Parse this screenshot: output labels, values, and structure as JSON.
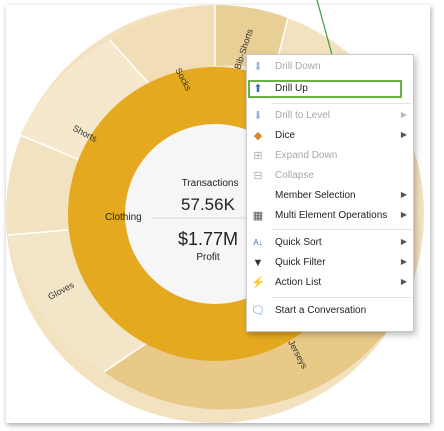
{
  "chart": {
    "center_top_label": "Transactions",
    "center_top_value": "57.56K",
    "center_bottom_value": "$1.77M",
    "center_bottom_label": "Profit",
    "inner_label": "Clothing",
    "outer_labels": {
      "socks": "Socks",
      "bike_shorts": "Bib-Shorts",
      "shorts": "Shorts",
      "gloves": "Gloves",
      "jerseys": "Jerseys"
    }
  },
  "menu": {
    "items": [
      {
        "label": "Drill Down",
        "icon": "arrow-down-icon",
        "disabled": true
      },
      {
        "label": "Drill Up",
        "icon": "arrow-up-icon",
        "disabled": false
      },
      {
        "label": "Drill to Level",
        "icon": "arrow-down-level-icon",
        "disabled": true,
        "submenu": true
      },
      {
        "label": "Dice",
        "icon": "cube-icon",
        "disabled": false,
        "submenu": true
      },
      {
        "label": "Expand Down",
        "icon": "expand-icon",
        "disabled": true
      },
      {
        "label": "Collapse",
        "icon": "collapse-icon",
        "disabled": true
      },
      {
        "label": "Member Selection",
        "icon": "",
        "disabled": false,
        "submenu": true
      },
      {
        "label": "Multi Element Operations",
        "icon": "grid-icon",
        "disabled": false,
        "submenu": true
      },
      {
        "label": "Quick Sort",
        "icon": "sort-icon",
        "disabled": false,
        "submenu": true
      },
      {
        "label": "Quick Filter",
        "icon": "filter-icon",
        "disabled": false,
        "submenu": true
      },
      {
        "label": "Action List",
        "icon": "lightning-icon",
        "disabled": false,
        "submenu": true
      },
      {
        "label": "Start a Conversation",
        "icon": "chat-icon",
        "disabled": false
      }
    ]
  },
  "colors": {
    "inner_ring": "#e5a920",
    "outer_light": "#f3e2c0",
    "outer_mid": "#ecd09c",
    "outer_bibshorts": "#e8cf96",
    "outer_jerseys": "#e9c987",
    "highlight": "#68b344",
    "pointer": "#3c9a3c"
  }
}
